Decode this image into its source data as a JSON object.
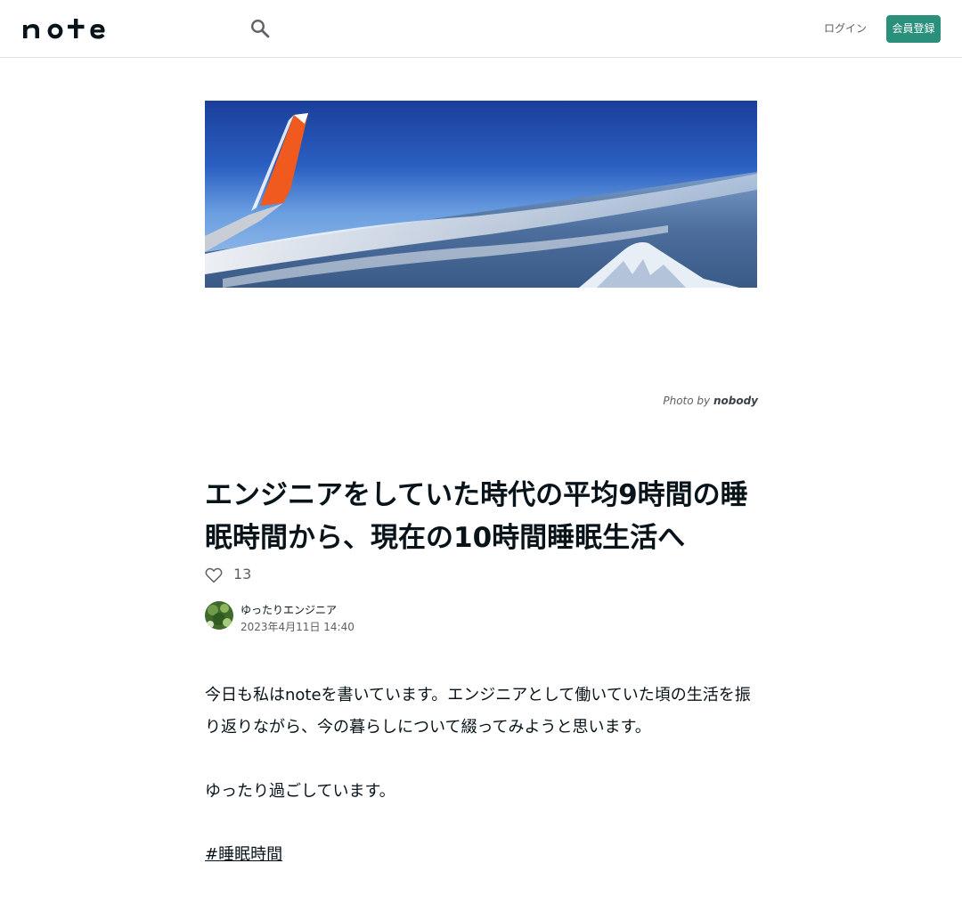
{
  "header": {
    "logo_text": "note",
    "login_label": "ログイン",
    "signup_label": "会員登録"
  },
  "hero": {
    "credit_prefix": "Photo by",
    "credit_name": "nobody"
  },
  "article": {
    "title": "エンジニアをしていた時代の平均9時間の睡眠時間から、現在の10時間睡眠生活へ",
    "likes": "13",
    "author": "ゆったりエンジニア",
    "date": "2023年4月11日 14:40",
    "paragraphs": [
      "今日も私はnoteを書いています。エンジニアとして働いていた頃の生活を振り返りながら、今の暮らしについて綴ってみようと思います。",
      "ゆったり過ごしています。"
    ],
    "hashtag": "#睡眠時間"
  },
  "colors": {
    "brand": "#2a8f7b",
    "text": "#08131a",
    "muted": "#5a6066"
  },
  "icons": [
    "note-logo",
    "search-icon",
    "heart-icon"
  ]
}
